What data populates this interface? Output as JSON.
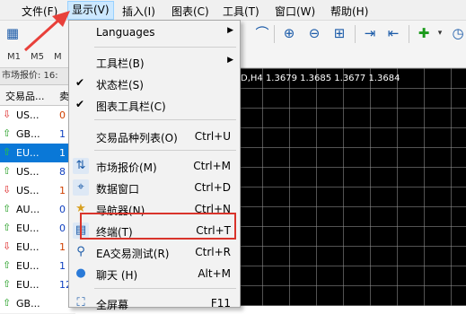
{
  "menubar": {
    "items": [
      {
        "label": "文件(F)"
      },
      {
        "label": "显示(V)"
      },
      {
        "label": "插入(I)"
      },
      {
        "label": "图表(C)"
      },
      {
        "label": "工具(T)"
      },
      {
        "label": "窗口(W)"
      },
      {
        "label": "帮助(H)"
      }
    ]
  },
  "timeframes": [
    "M1",
    "M5",
    "M"
  ],
  "market_watch": {
    "title": "市场报价: 16:",
    "col_symbol": "交易品...",
    "col_bid": "卖",
    "rows": [
      {
        "symbol": "US...",
        "value": "0",
        "direction": "down"
      },
      {
        "symbol": "GB...",
        "value": "1",
        "direction": "up"
      },
      {
        "symbol": "EU...",
        "value": "1",
        "direction": "up"
      },
      {
        "symbol": "US...",
        "value": "8",
        "direction": "up"
      },
      {
        "symbol": "US...",
        "value": "1",
        "direction": "down"
      },
      {
        "symbol": "AU...",
        "value": "0",
        "direction": "up"
      },
      {
        "symbol": "EU...",
        "value": "0",
        "direction": "up"
      },
      {
        "symbol": "EU...",
        "value": "1",
        "direction": "down"
      },
      {
        "symbol": "EU...",
        "value": "1",
        "direction": "up"
      },
      {
        "symbol": "EU...",
        "value": "12",
        "direction": "up"
      },
      {
        "symbol": "GB...",
        "value": "",
        "direction": "up"
      }
    ]
  },
  "chart": {
    "info": "D,H4  1.3679 1.3685 1.3677 1.3684"
  },
  "view_menu": {
    "languages": "Languages",
    "toolbars": "工具栏(B)",
    "statusbar": "状态栏(S)",
    "chart_toolbar": "图表工具栏(C)",
    "symbols": "交易品种列表(O)",
    "symbols_sc": "Ctrl+U",
    "market_watch": "市场报价(M)",
    "market_watch_sc": "Ctrl+M",
    "data_window": "数据窗口",
    "data_window_sc": "Ctrl+D",
    "navigator": "导航器(N)",
    "navigator_sc": "Ctrl+N",
    "terminal": "终端(T)",
    "terminal_sc": "Ctrl+T",
    "tester": "EA交易测试(R)",
    "tester_sc": "Ctrl+R",
    "chat": "聊天 (H)",
    "chat_sc": "Alt+M",
    "fullscreen": "全屏幕",
    "fullscreen_sc": "F11"
  },
  "colors": {
    "highlight": "#d9342b",
    "selected_row": "#0a78d7",
    "arrow": "#e8403a"
  }
}
